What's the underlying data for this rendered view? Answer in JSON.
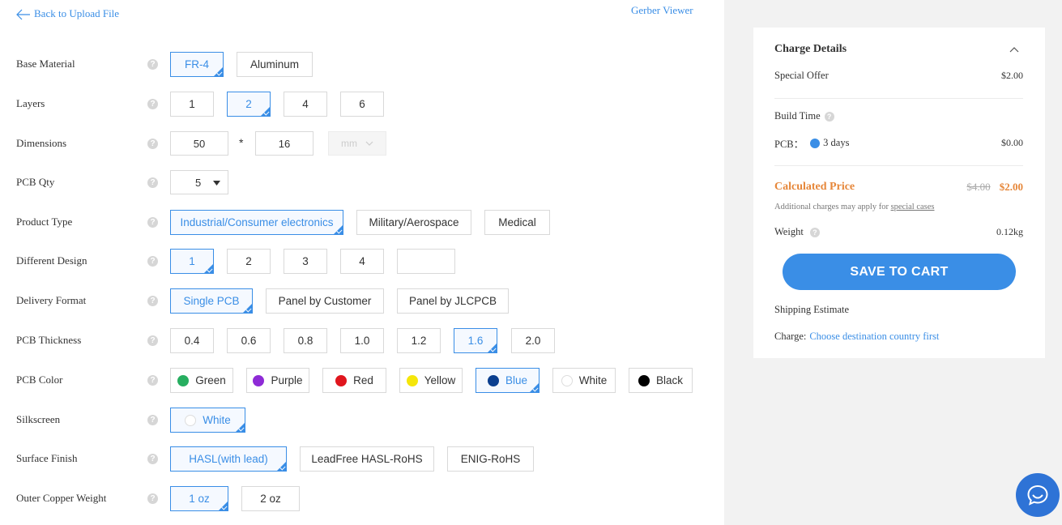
{
  "nav": {
    "back_label": "Back to Upload File",
    "gerber_label": "Gerber Viewer"
  },
  "form": {
    "base_material": {
      "label": "Base Material",
      "options": [
        "FR-4",
        "Aluminum"
      ],
      "selected": "FR-4"
    },
    "layers": {
      "label": "Layers",
      "options": [
        "1",
        "2",
        "4",
        "6"
      ],
      "selected": "2"
    },
    "dimensions": {
      "label": "Dimensions",
      "width": "50",
      "height": "16",
      "separator": "*",
      "unit": "mm"
    },
    "pcb_qty": {
      "label": "PCB Qty",
      "value": "5"
    },
    "product_type": {
      "label": "Product Type",
      "options": [
        "Industrial/Consumer electronics",
        "Military/Aerospace",
        "Medical"
      ],
      "selected": "Industrial/Consumer electronics"
    },
    "different_design": {
      "label": "Different Design",
      "options": [
        "1",
        "2",
        "3",
        "4"
      ],
      "selected": "1",
      "custom_value": ""
    },
    "delivery_format": {
      "label": "Delivery Format",
      "options": [
        "Single PCB",
        "Panel by Customer",
        "Panel by JLCPCB"
      ],
      "selected": "Single PCB"
    },
    "pcb_thickness": {
      "label": "PCB Thickness",
      "options": [
        "0.4",
        "0.6",
        "0.8",
        "1.0",
        "1.2",
        "1.6",
        "2.0"
      ],
      "selected": "1.6"
    },
    "pcb_color": {
      "label": "PCB Color",
      "options": [
        {
          "name": "Green",
          "color": "#27ae60"
        },
        {
          "name": "Purple",
          "color": "#8e2bd6"
        },
        {
          "name": "Red",
          "color": "#e0161e"
        },
        {
          "name": "Yellow",
          "color": "#f5e60a"
        },
        {
          "name": "Blue",
          "color": "#0b3f8f"
        },
        {
          "name": "White",
          "color": "#ffffff"
        },
        {
          "name": "Black",
          "color": "#000000"
        }
      ],
      "selected": "Blue"
    },
    "silkscreen": {
      "label": "Silkscreen",
      "options": [
        {
          "name": "White",
          "color": "#ffffff"
        }
      ],
      "selected": "White"
    },
    "surface_finish": {
      "label": "Surface Finish",
      "options": [
        "HASL(with lead)",
        "LeadFree HASL-RoHS",
        "ENIG-RoHS"
      ],
      "selected": "HASL(with lead)"
    },
    "outer_copper": {
      "label": "Outer Copper Weight",
      "options": [
        "1 oz",
        "2 oz"
      ],
      "selected": "1 oz"
    },
    "help_glyph": "?"
  },
  "charges": {
    "title": "Charge Details",
    "special_offer": {
      "label": "Special Offer",
      "value": "$2.00"
    },
    "build_time": {
      "label": "Build Time"
    },
    "pcb": {
      "label": "PCB：",
      "option": "3 days",
      "value": "$0.00"
    },
    "calculated": {
      "label": "Calculated Price",
      "old": "$4.00",
      "new": "$2.00"
    },
    "note": {
      "text": "Additional charges may apply for ",
      "link": "special cases"
    },
    "weight": {
      "label": "Weight",
      "value": "0.12kg"
    },
    "save_button": "SAVE TO CART",
    "shipping": {
      "label": "Shipping Estimate",
      "charge_label": "Charge:",
      "charge_link": "Choose destination country first"
    }
  },
  "colors": {
    "accent": "#3a8ee6",
    "price": "#e6873a"
  }
}
